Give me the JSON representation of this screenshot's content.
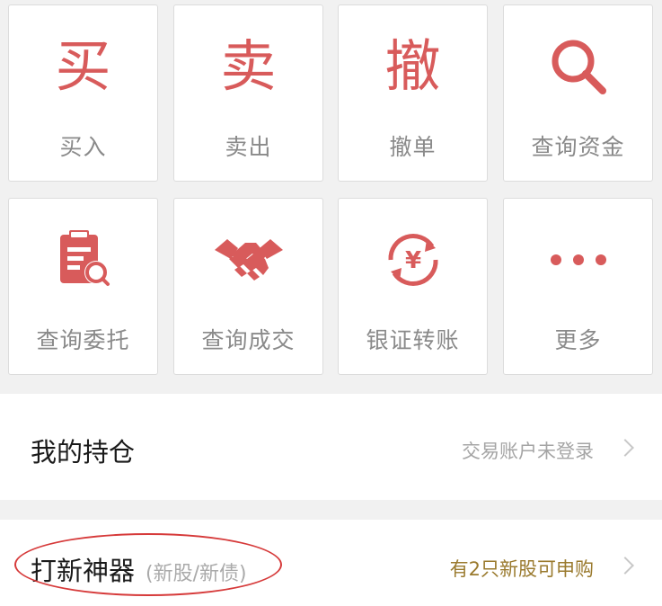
{
  "grid": {
    "items": [
      {
        "glyph": "买",
        "label": "买入",
        "icon": "buy-glyph-icon"
      },
      {
        "glyph": "卖",
        "label": "卖出",
        "icon": "sell-glyph-icon"
      },
      {
        "glyph": "撤",
        "label": "撤单",
        "icon": "cancel-glyph-icon"
      },
      {
        "glyph": "",
        "label": "查询资金",
        "icon": "search-icon"
      },
      {
        "glyph": "",
        "label": "查询委托",
        "icon": "clipboard-search-icon"
      },
      {
        "glyph": "",
        "label": "查询成交",
        "icon": "handshake-icon"
      },
      {
        "glyph": "",
        "label": "银证转账",
        "icon": "yen-transfer-icon"
      },
      {
        "glyph": "",
        "label": "更多",
        "icon": "more-dots-icon"
      }
    ]
  },
  "positions": {
    "title": "我的持仓",
    "status": "交易账户未登录"
  },
  "ipo": {
    "title": "打新神器",
    "subtitle": "(新股/新债)",
    "status": "有2只新股可申购"
  },
  "colors": {
    "accent": "#d85b5b",
    "label": "#8a8a8a",
    "ipo_status": "#9a7a2e",
    "annotation": "#d63a3a"
  }
}
